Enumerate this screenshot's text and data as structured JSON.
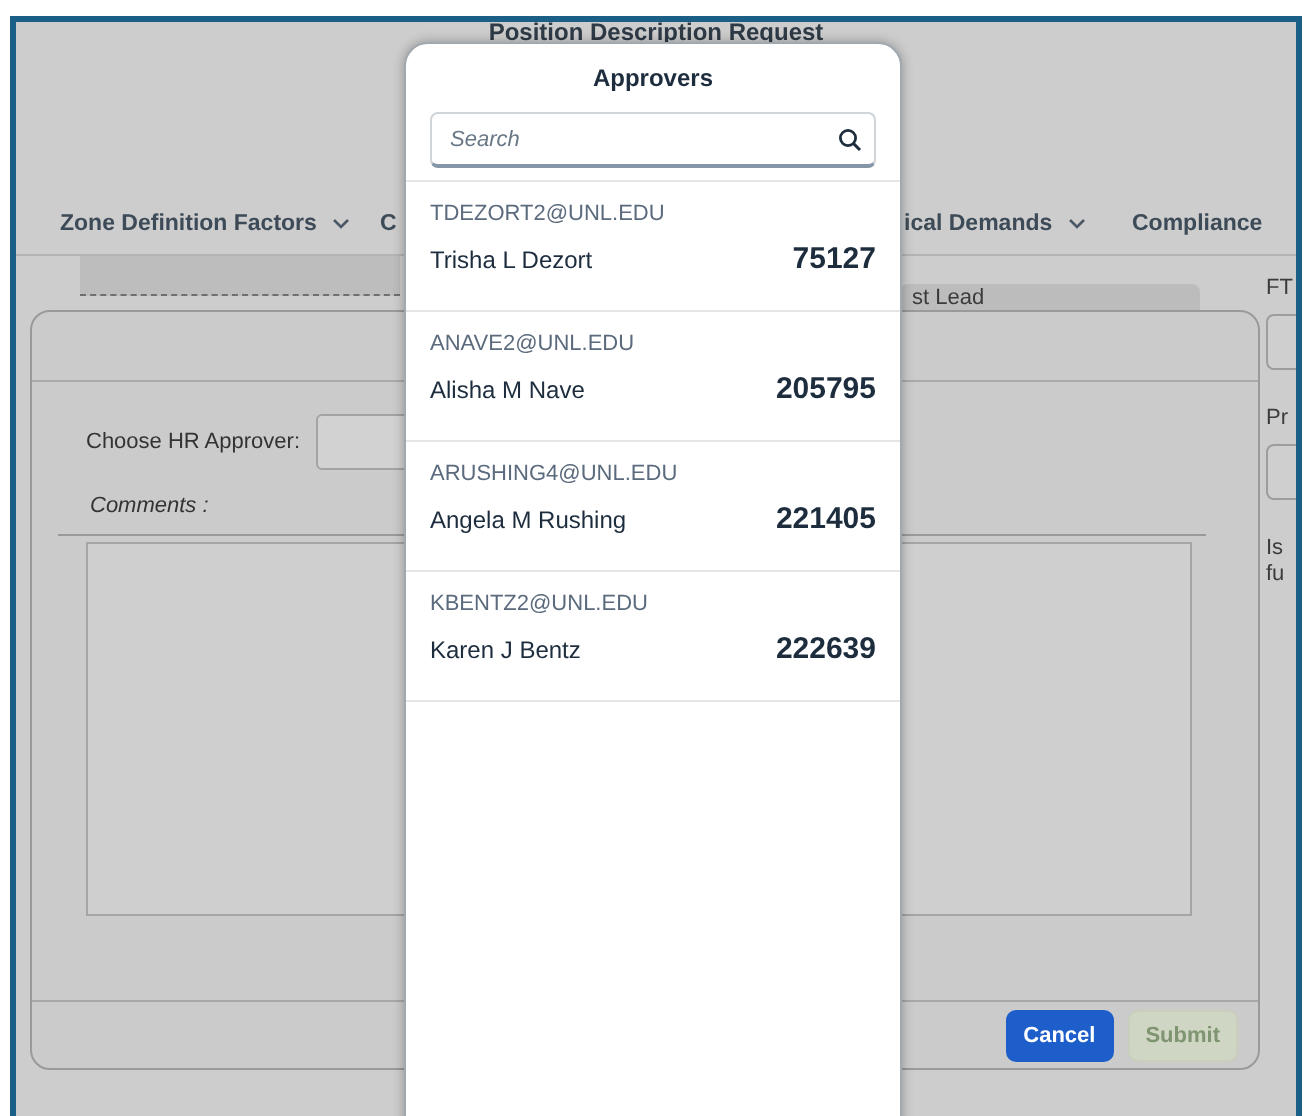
{
  "background_page": {
    "title": "Position Description Request",
    "tabs": [
      {
        "label": "Zone Definition Factors",
        "has_menu": true
      },
      {
        "label": "C",
        "has_menu": false
      },
      {
        "label": "ical Demands",
        "has_menu": true
      },
      {
        "label": "Compliance",
        "has_menu": false
      }
    ],
    "section_label": "st Lead",
    "side_labels": [
      "FT",
      "Pr",
      "Is",
      "fu"
    ]
  },
  "dialog": {
    "field_label": "Choose HR Approver:",
    "comments_label": "Comments :",
    "buttons": [
      {
        "label": "Cancel",
        "disabled": false
      },
      {
        "label": "Submit",
        "disabled": true
      }
    ]
  },
  "approvers_popover": {
    "title": "Approvers",
    "search": {
      "placeholder": "Search"
    },
    "items": [
      {
        "email": "TDEZORT2@UNL.EDU",
        "name": "Trisha L Dezort",
        "number": "75127"
      },
      {
        "email": "ANAVE2@UNL.EDU",
        "name": "Alisha M Nave",
        "number": "205795"
      },
      {
        "email": "ARUSHING4@UNL.EDU",
        "name": "Angela M Rushing",
        "number": "221405"
      },
      {
        "email": "KBENTZ2@UNL.EDU",
        "name": "Karen J Bentz",
        "number": "222639"
      }
    ]
  }
}
